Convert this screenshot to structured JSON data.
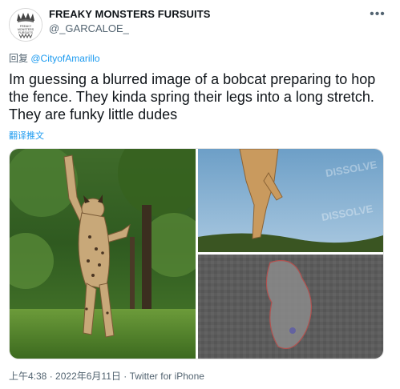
{
  "author": {
    "display_name": "FREAKY MONSTERS FURSUITS",
    "handle": "@_GARCALOE_",
    "avatar_logo_text": "FREAKY MONSTERS FURSUITS"
  },
  "reply": {
    "prefix": "回复",
    "mention": "@CityofAmarillo"
  },
  "tweet": {
    "text": "Im guessing a blurred image of a bobcat preparing to hop the fence. They kinda spring their legs into a long stretch. They are funky little dudes",
    "translate_label": "翻译推文"
  },
  "media": {
    "watermark": "DISSOLVE",
    "images": [
      "bobcat-leaping",
      "bobcat-legs-closeup",
      "blurred-bobcat"
    ]
  },
  "meta": {
    "time": "上午4:38",
    "separator": "·",
    "date": "2022年6月11日",
    "source": "Twitter for iPhone"
  },
  "more_icon": "more-horizontal-icon"
}
